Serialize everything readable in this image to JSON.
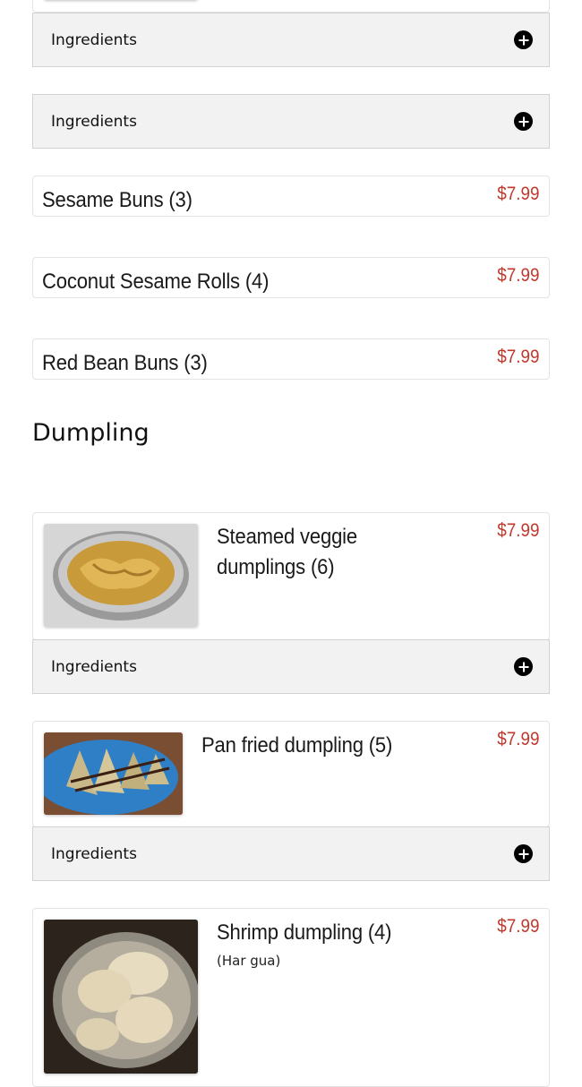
{
  "menu_top": {
    "ingredients_rows": [
      {
        "label": "Ingredients",
        "icon": "plus-circle-icon"
      },
      {
        "label": "Ingredients",
        "icon": "plus-circle-icon"
      }
    ],
    "items": [
      {
        "name": "Sesame Buns (3)",
        "price": "$7.99"
      },
      {
        "name": "Coconut Sesame Rolls (4)",
        "price": "$7.99"
      },
      {
        "name": "Red Bean Buns (3)",
        "price": "$7.99"
      }
    ]
  },
  "dumpling_section": {
    "title": "Dumpling",
    "items": [
      {
        "name_line1": "Steamed veggie",
        "name_line2": "dumplings (6)",
        "price": "$7.99",
        "image": "veggie-dumplings-photo",
        "ingredients_label": "Ingredients"
      },
      {
        "name": "Pan fried dumpling (5)",
        "price": "$7.99",
        "image": "pan-fried-dumplings-photo",
        "ingredients_label": "Ingredients"
      },
      {
        "name": "Shrimp dumpling (4)",
        "subtitle": "(Har gua)",
        "price": "$7.99",
        "image": "shrimp-dumplings-photo"
      }
    ]
  },
  "colors": {
    "price": "#c0392b",
    "ingredients_bg": "#f2f2f2",
    "card_border": "#e3e3e3"
  }
}
